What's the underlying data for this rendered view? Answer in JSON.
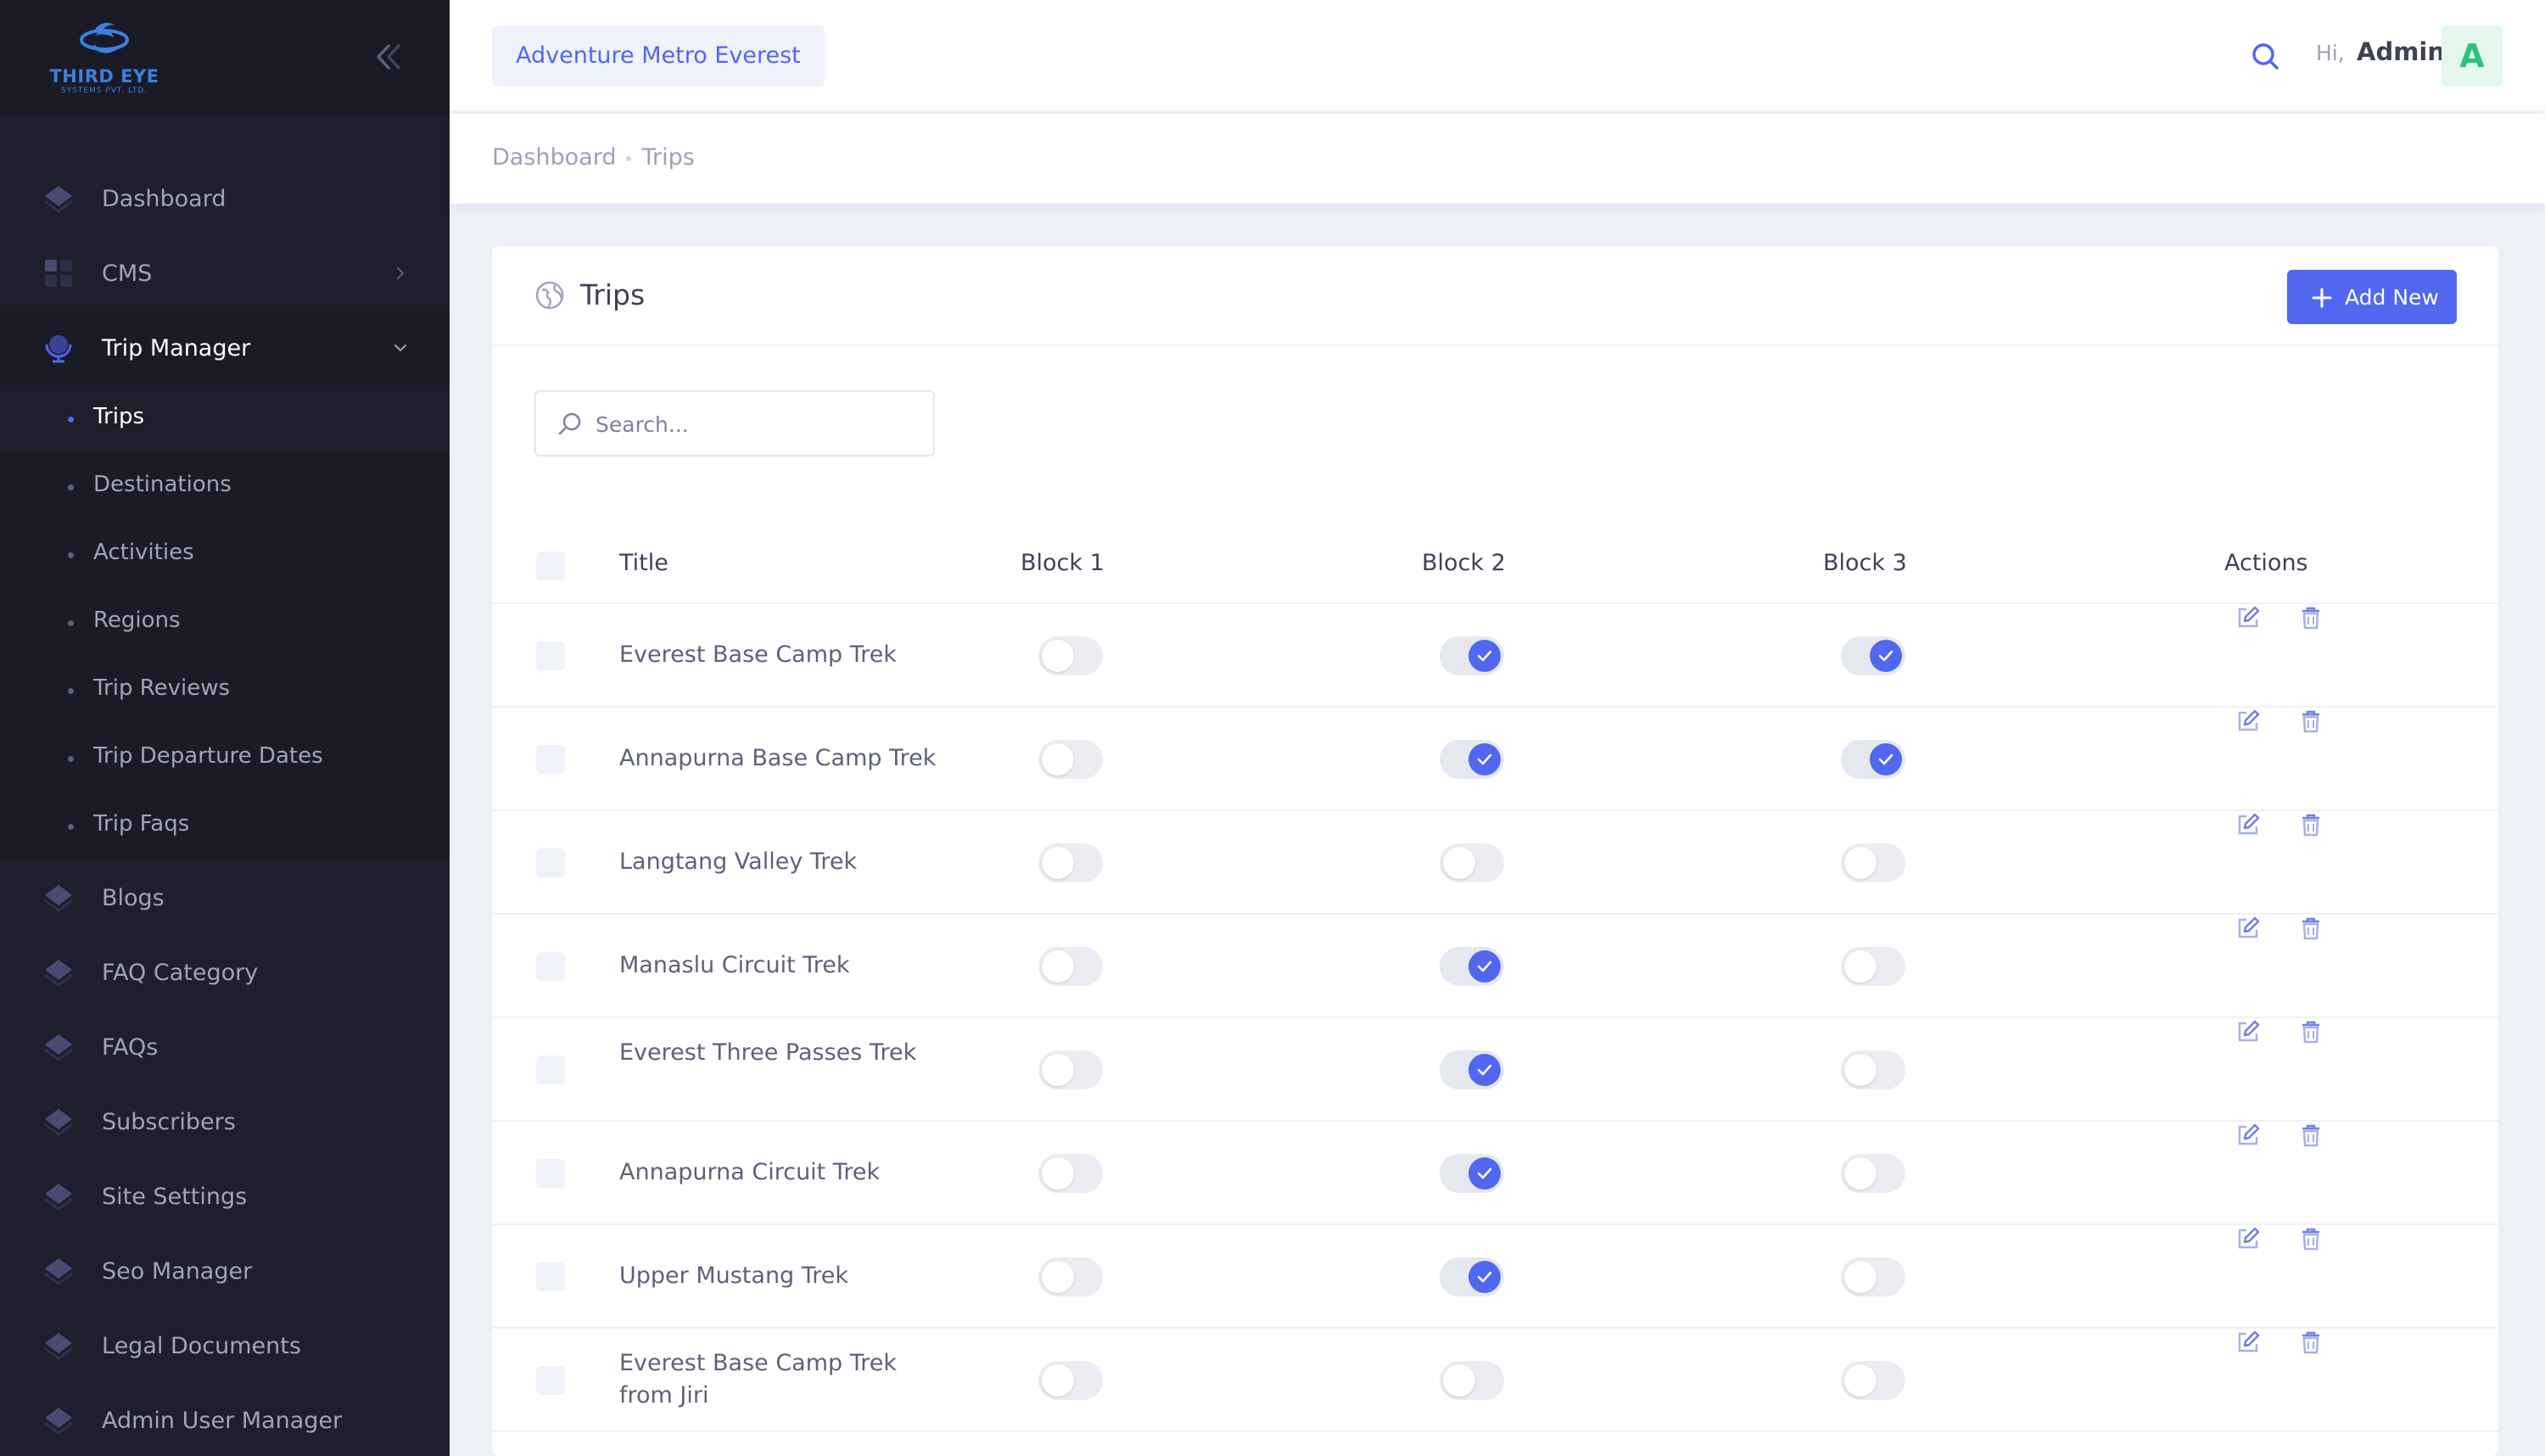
{
  "brand": {
    "name": "THIRD EYE",
    "sub": "SYSTEMS PVT. LTD."
  },
  "sidebar": {
    "items": [
      {
        "label": "Dashboard",
        "icon": "layers-icon"
      },
      {
        "label": "CMS",
        "icon": "grid-icon",
        "has_arrow": true
      },
      {
        "label": "Trip Manager",
        "icon": "globe-icon",
        "expanded": true
      },
      {
        "label": "Blogs",
        "icon": "layers-icon"
      },
      {
        "label": "FAQ Category",
        "icon": "layers-icon"
      },
      {
        "label": "FAQs",
        "icon": "layers-icon"
      },
      {
        "label": "Subscribers",
        "icon": "layers-icon"
      },
      {
        "label": "Site Settings",
        "icon": "layers-icon"
      },
      {
        "label": "Seo Manager",
        "icon": "layers-icon"
      },
      {
        "label": "Legal Documents",
        "icon": "layers-icon"
      },
      {
        "label": "Admin User Manager",
        "icon": "layers-icon"
      }
    ],
    "trip_submenu": [
      {
        "label": "Trips",
        "active": true
      },
      {
        "label": "Destinations"
      },
      {
        "label": "Activities"
      },
      {
        "label": "Regions"
      },
      {
        "label": "Trip Reviews"
      },
      {
        "label": "Trip Departure Dates"
      },
      {
        "label": "Trip Faqs"
      }
    ]
  },
  "header": {
    "org": "Adventure Metro Everest",
    "greeting": "Hi,",
    "user": "Admin",
    "avatar_letter": "A"
  },
  "breadcrumb": [
    "Dashboard",
    "Trips"
  ],
  "card": {
    "title": "Trips",
    "add_button": "Add New",
    "search_placeholder": "Search..."
  },
  "table": {
    "columns": [
      "Title",
      "Block 1",
      "Block 2",
      "Block 3",
      "Actions"
    ],
    "rows": [
      {
        "title": "Everest Base Camp Trek",
        "block1": false,
        "block2": true,
        "block3": true
      },
      {
        "title": "Annapurna Base Camp Trek",
        "block1": false,
        "block2": true,
        "block3": true
      },
      {
        "title": "Langtang Valley Trek",
        "block1": false,
        "block2": false,
        "block3": false
      },
      {
        "title": "Manaslu Circuit Trek",
        "block1": false,
        "block2": true,
        "block3": false
      },
      {
        "title": "Everest Three Passes Trek",
        "block1": false,
        "block2": true,
        "block3": false
      },
      {
        "title": "Annapurna Circuit Trek",
        "block1": false,
        "block2": true,
        "block3": false
      },
      {
        "title": "Upper Mustang Trek",
        "block1": false,
        "block2": true,
        "block3": false
      },
      {
        "title": "Everest Base Camp Trek from Jiri",
        "block1": false,
        "block2": false,
        "block3": false
      }
    ]
  },
  "colors": {
    "accent": "#5167f0",
    "sidebar_bg": "#1e1e2d",
    "avatar_text": "#2ec27e"
  }
}
